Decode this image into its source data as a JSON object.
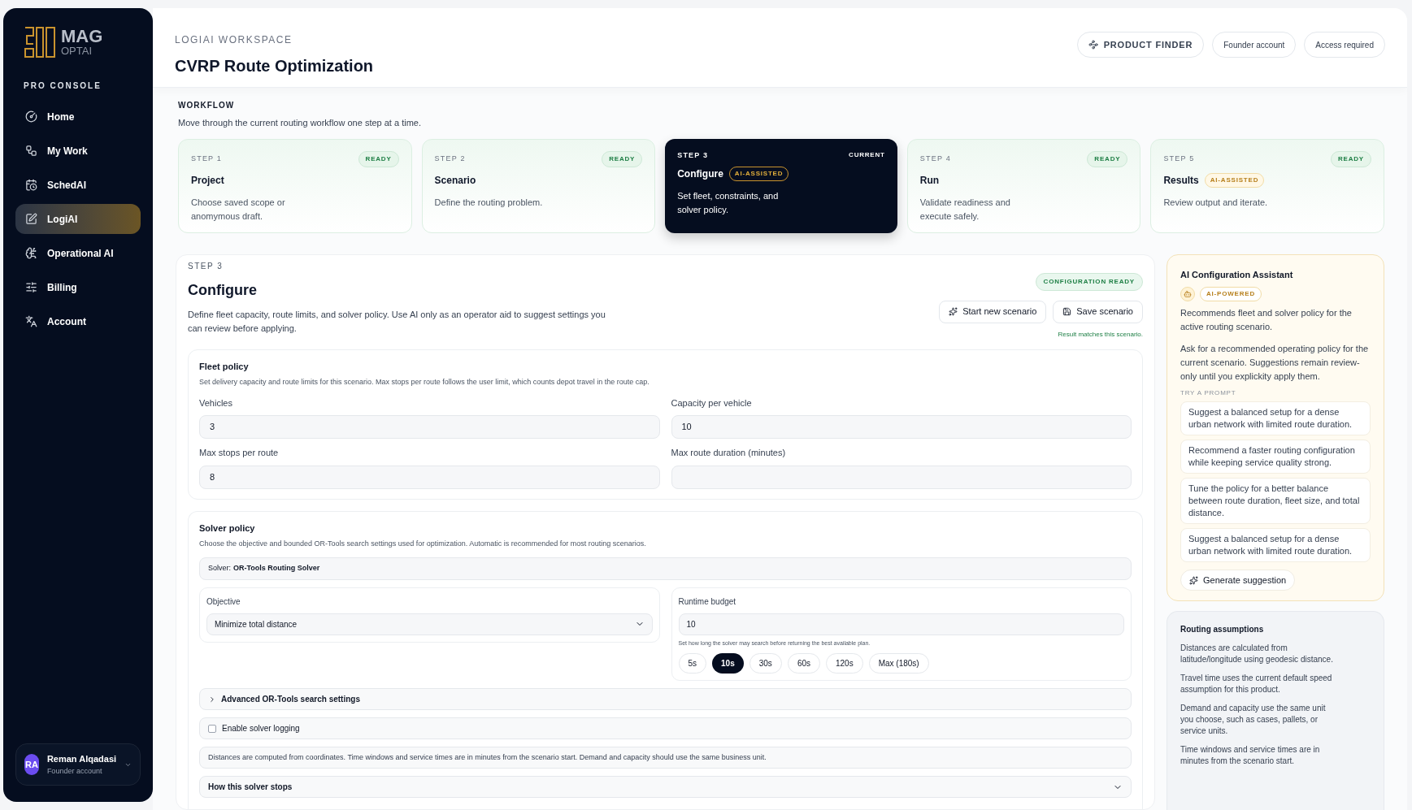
{
  "sidebar": {
    "logo": {
      "line1": "MAG",
      "line2": "OPTAI"
    },
    "section": "PRO CONSOLE",
    "items": [
      {
        "label": "Home",
        "selected": false
      },
      {
        "label": "My Work",
        "selected": false
      },
      {
        "label": "SchedAI",
        "selected": false
      },
      {
        "label": "LogiAI",
        "selected": true
      },
      {
        "label": "Operational AI",
        "selected": false
      },
      {
        "label": "Billing",
        "selected": false
      },
      {
        "label": "Account",
        "selected": false
      }
    ],
    "user": {
      "initials": "RA",
      "name": "Reman Alqadasi",
      "role": "Founder account"
    }
  },
  "header": {
    "eyebrow": "LOGIAI WORKSPACE",
    "title": "CVRP Route Optimization",
    "product_finder": "PRODUCT FINDER",
    "chips": [
      "Founder account",
      "Access required"
    ]
  },
  "workflow": {
    "title": "WORKFLOW",
    "description": "Move through the current routing workflow one step at a time.",
    "steps": [
      {
        "step": "STEP 1",
        "title": "Project",
        "status": "READY",
        "description": "Choose saved scope or anomymous draft.",
        "selected": false
      },
      {
        "step": "STEP 2",
        "title": "Scenario",
        "status": "READY",
        "description": "Define the routing problem.",
        "selected": false
      },
      {
        "step": "STEP 3",
        "title": "Configure",
        "badge": "AI-ASSISTED",
        "status": "CURRENT",
        "description": "Set fleet, constraints, and solver policy.",
        "selected": true
      },
      {
        "step": "STEP 4",
        "title": "Run",
        "status": "READY",
        "description": "Validate readiness and execute safely.",
        "selected": false
      },
      {
        "step": "STEP 5",
        "title": "Results",
        "badge": "AI-ASSISTED",
        "status": "READY",
        "description": "Review output and iterate.",
        "selected": false
      }
    ]
  },
  "configure": {
    "eyebrow": "STEP 3",
    "title": "Configure",
    "description": "Define fleet capacity, route limits, and solver policy. Use AI only as an operator aid to suggest settings you can review before applying.",
    "status": "CONFIGURATION READY",
    "actions": [
      "Start new scenario",
      "Save scenario"
    ],
    "match_note": "Result matches this scenario.",
    "fleet": {
      "title": "Fleet policy",
      "description": "Set delivery capacity and route limits for this scenario. Max stops per route follows the user limit, which counts depot travel in the route cap.",
      "fields": [
        {
          "label": "Vehicles",
          "value": "3"
        },
        {
          "label": "Capacity per vehicle",
          "value": "10"
        },
        {
          "label": "Max stops per route",
          "value": "8"
        },
        {
          "label": "Max route duration (minutes)"
        }
      ]
    },
    "solver": {
      "title": "Solver policy",
      "description": "Choose the objective and bounded OR-Tools search settings used for optimization. Automatic is recommended for most routing scenarios.",
      "solver_label": "Solver:",
      "solver_name": "OR-Tools Routing Solver",
      "objective": {
        "label": "Objective",
        "value": "Minimize total distance"
      },
      "runtime": {
        "label": "Runtime budget",
        "value": "10",
        "hint": "Set how long the solver may search before returning the best available plan.",
        "presets": [
          {
            "label": "5s",
            "selected": false
          },
          {
            "label": "10s",
            "selected": true
          },
          {
            "label": "30s",
            "selected": false
          },
          {
            "label": "60s",
            "selected": false
          },
          {
            "label": "120s",
            "selected": false
          },
          {
            "label": "Max (180s)",
            "selected": false
          }
        ]
      },
      "advanced": {
        "label": "Advanced OR-Tools search settings",
        "expanded": false
      },
      "logging": {
        "label": "Enable solver logging",
        "checked": false
      },
      "note": "Distances are computed from coordinates. Time windows and service times are in minutes from the scenario start. Demand and capacity should use the same business unit.",
      "stops": {
        "label": "How this solver stops",
        "expanded": false
      }
    }
  },
  "assistant": {
    "title": "AI Configuration Assistant",
    "badge": "AI-POWERED",
    "intro": "Recommends fleet and solver policy for the active routing scenario.",
    "body": "Ask for a recommended operating policy for the current scenario. Suggestions remain review-only until you explickity apply them.",
    "prompt_label": "TRY A PROMPT",
    "prompts": [
      "Suggest a balanced setup for a dense urban network with limited route duration.",
      "Recommend a faster routing configuration while keeping service quality strong.",
      "Tune the policy for a better balance between route duration, fleet size, and total distance.",
      "Suggest a balanced setup for a dense urban network with limited route duration."
    ],
    "button": "Generate suggestion"
  },
  "assumptions": {
    "title": "Routing assumptions",
    "items": [
      "Distances are calculated from latitude/longitude using geodesic distance.",
      "Travel time uses the current default speed assumption for this product.",
      "Demand and capacity use the same unit you choose, such as cases, pallets, or service units.",
      "Time windows and service times are in minutes from the scenario start."
    ]
  }
}
